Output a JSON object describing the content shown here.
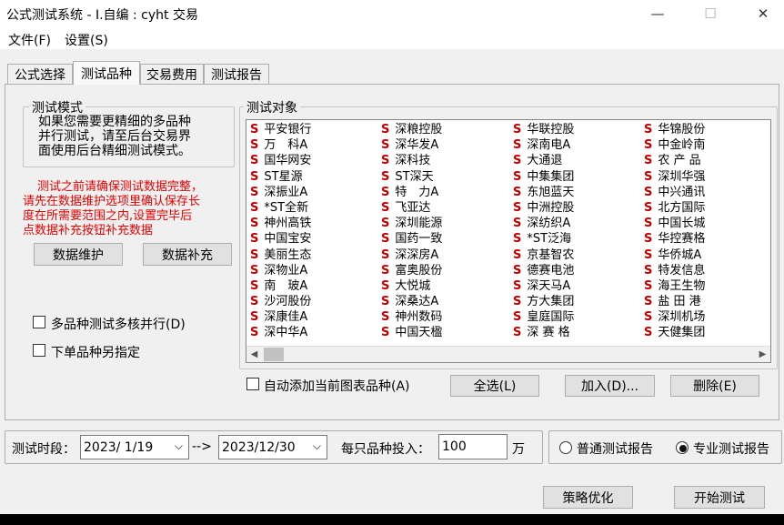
{
  "window": {
    "title": "公式测试系统 - I.自编 : cyht 交易",
    "minimize": "—",
    "maximize": "☐",
    "close": "✕"
  },
  "menu": [
    {
      "label": "文件(F)"
    },
    {
      "label": "设置(S)"
    }
  ],
  "tabs": [
    {
      "label": "公式选择"
    },
    {
      "label": "测试品种"
    },
    {
      "label": "交易费用"
    },
    {
      "label": "测试报告"
    }
  ],
  "test_mode": {
    "legend": "测试模式",
    "desc": [
      "如果您需要更精细的多品种",
      "并行测试，请至后台交易界",
      "面使用后台精细测试模式。"
    ],
    "warning": [
      "测试之前请确保测试数据完整，",
      "请先在数据维护选项里确认保存长",
      "度在所需要范围之内,设置完毕后",
      "点数据补充按钮补充数据"
    ],
    "data_maintain_label": "数据维护",
    "data_supplement_label": "数据补充"
  },
  "options": {
    "multicore_label": "多品种测试多核并行(D)",
    "order_symbol_label": "下单品种另指定"
  },
  "test_objects": {
    "legend": "测试对象",
    "marker": "S",
    "columns": [
      [
        "平安银行",
        "万　科A",
        "国华网安",
        "ST星源",
        "深振业A",
        "*ST全新",
        "神州高铁",
        "中国宝安",
        "美丽生态",
        "深物业A",
        "南　玻A",
        "沙河股份",
        "深康佳A",
        "深中华A"
      ],
      [
        "深粮控股",
        "深华发A",
        "深科技",
        "ST深天",
        "特　力A",
        "飞亚达",
        "深圳能源",
        "国药一致",
        "深深房A",
        "富奥股份",
        "大悦城",
        "深桑达A",
        "神州数码",
        "中国天楹"
      ],
      [
        "华联控股",
        "深南电A",
        "大通退",
        "中集集团",
        "东旭蓝天",
        "中洲控股",
        "深纺织A",
        "*ST泛海",
        "京基智农",
        "德赛电池",
        "深天马A",
        "方大集团",
        "皇庭国际",
        "深 赛 格"
      ],
      [
        "华锦股份",
        "中金岭南",
        "农 产 品",
        "深圳华强",
        "中兴通讯",
        "北方国际",
        "中国长城",
        "华控赛格",
        "华侨城A",
        "特发信息",
        "海王生物",
        "盐 田 港",
        "深圳机场",
        "天健集团"
      ]
    ],
    "auto_add_label": "自动添加当前图表品种(A)",
    "select_all_label": "全选(L)",
    "add_label": "加入(D)...",
    "delete_label": "删除(E)"
  },
  "period": {
    "label": "测试时段：",
    "start": "2023/ 1/19",
    "arrow": "-->",
    "end": "2023/12/30",
    "invest_label": "每只品种投入：",
    "invest_value": "100",
    "unit": "万"
  },
  "report_type": {
    "normal_label": "普通测试报告",
    "pro_label": "专业测试报告",
    "selected": "pro"
  },
  "actions": {
    "optimize_label": "策略优化",
    "start_label": "开始测试"
  }
}
